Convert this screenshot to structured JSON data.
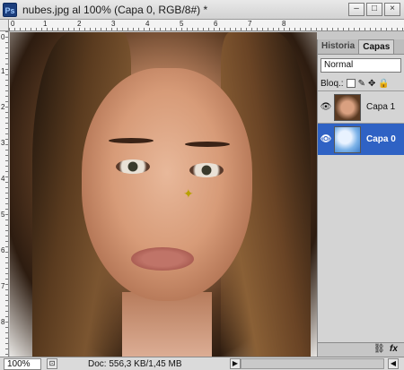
{
  "window": {
    "title": "nubes.jpg al 100% (Capa 0, RGB/8#) *",
    "app_icon": "Ps",
    "buttons": [
      "–",
      "□",
      "×"
    ]
  },
  "rulers": {
    "top_labels": [
      "0",
      "1",
      "2",
      "3",
      "4",
      "5",
      "6",
      "7",
      "8"
    ],
    "left_labels": [
      "0",
      "1",
      "2",
      "3",
      "4",
      "5",
      "6",
      "7",
      "8"
    ]
  },
  "panel": {
    "tabs": [
      "Historia",
      "Capas"
    ],
    "blend_mode": "Normal",
    "lock_label": "Bloq.:",
    "layers": [
      {
        "name": "Capa 1",
        "visible": true,
        "selected": false,
        "thumb": "face"
      },
      {
        "name": "Capa 0",
        "visible": true,
        "selected": true,
        "thumb": "clouds"
      }
    ],
    "bottom_icons": [
      "link-icon",
      "fx-icon"
    ]
  },
  "status": {
    "zoom": "100%",
    "doc": "Doc: 556,3 KB/1,45 MB"
  },
  "colors": {
    "selection": "#2f62c4",
    "panel_bg": "#d4d4d4"
  }
}
